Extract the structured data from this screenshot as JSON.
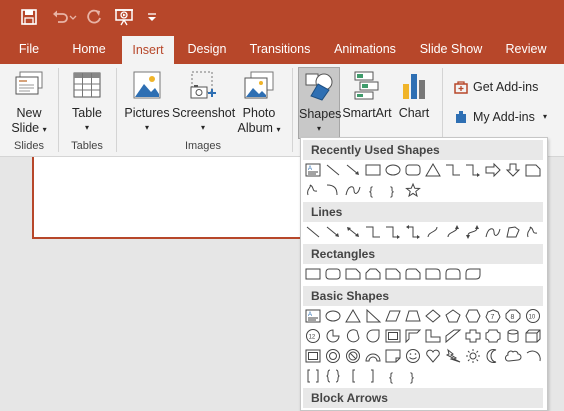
{
  "quick_access": {
    "icons": [
      "save-icon",
      "undo-icon",
      "undo-dropdown-icon",
      "redo-icon",
      "present-from-start-icon",
      "customize-toolbar-icon"
    ]
  },
  "tabs": [
    {
      "label": "File"
    },
    {
      "label": "Home"
    },
    {
      "label": "Insert",
      "active": true
    },
    {
      "label": "Design"
    },
    {
      "label": "Transitions"
    },
    {
      "label": "Animations"
    },
    {
      "label": "Slide Show"
    },
    {
      "label": "Review"
    }
  ],
  "ribbon": {
    "new_slide": {
      "line1": "New",
      "line2": "Slide"
    },
    "table": {
      "label": "Table"
    },
    "pictures": {
      "label": "Pictures"
    },
    "screenshot": {
      "label": "Screenshot"
    },
    "photo_album": {
      "line1": "Photo",
      "line2": "Album"
    },
    "shapes": {
      "label": "Shapes"
    },
    "smartart": {
      "label": "SmartArt"
    },
    "chart": {
      "label": "Chart"
    },
    "get_addins": {
      "label": "Get Add-ins"
    },
    "my_addins": {
      "label": "My Add-ins"
    },
    "groups": {
      "slides": "Slides",
      "tables": "Tables",
      "images": "Images"
    }
  },
  "shapes_panel": {
    "sections": [
      {
        "title": "Recently Used Shapes"
      },
      {
        "title": "Lines"
      },
      {
        "title": "Rectangles"
      },
      {
        "title": "Basic Shapes"
      },
      {
        "title": "Block Arrows"
      }
    ],
    "basic_labels": {
      "octagon": "8",
      "decagon": "10",
      "dodecagon": "12",
      "bracket_open": "{",
      "bracket_close": "}"
    }
  },
  "colors": {
    "accent": "#b7472a",
    "ribbon_bg": "#f3f3f3",
    "panel_header": "#e8e8e8",
    "workspace": "#e6e6e6"
  }
}
